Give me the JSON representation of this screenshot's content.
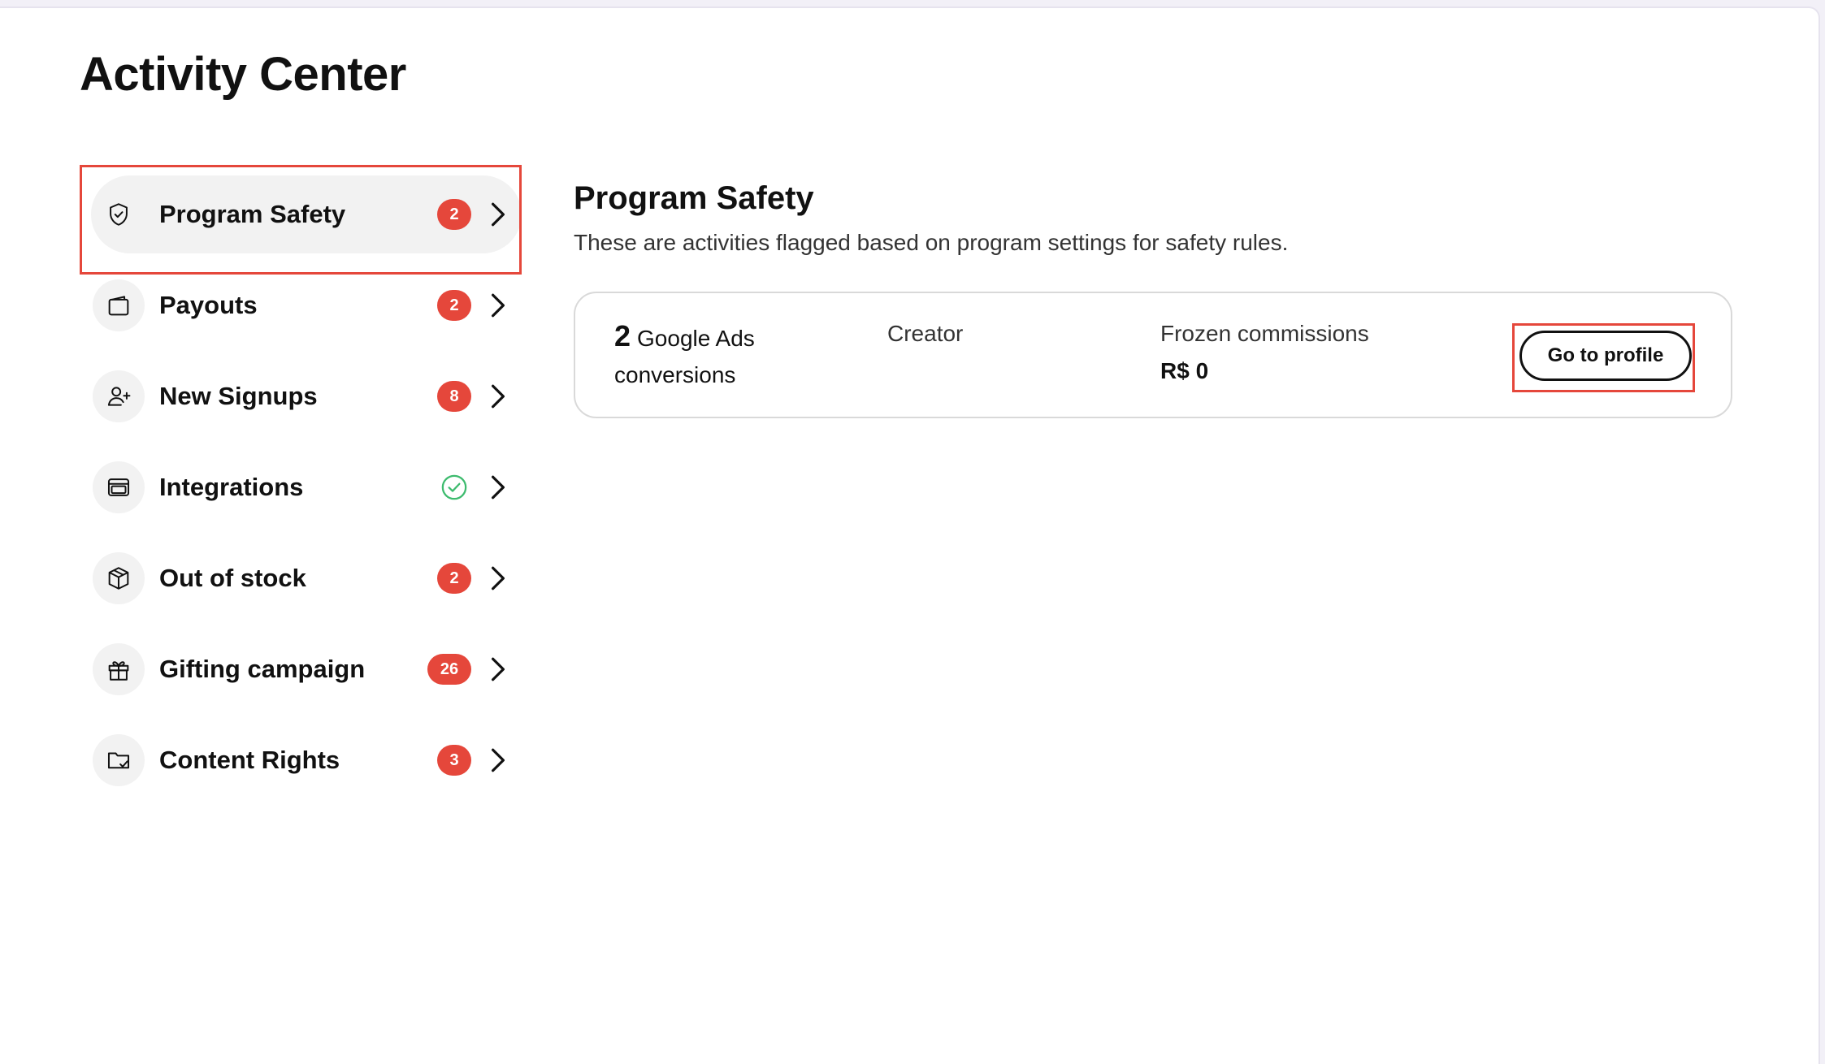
{
  "page": {
    "title": "Activity Center"
  },
  "sidebar": {
    "items": [
      {
        "label": "Program Safety",
        "badge": "2",
        "icon": "shield-icon",
        "active": true
      },
      {
        "label": "Payouts",
        "badge": "2",
        "icon": "wallet-icon",
        "active": false
      },
      {
        "label": "New Signups",
        "badge": "8",
        "icon": "user-plus-icon",
        "active": false
      },
      {
        "label": "Integrations",
        "status": "check",
        "icon": "browser-window-icon",
        "active": false
      },
      {
        "label": "Out of stock",
        "badge": "2",
        "icon": "box-icon",
        "active": false
      },
      {
        "label": "Gifting campaign",
        "badge": "26",
        "icon": "gift-icon",
        "active": false
      },
      {
        "label": "Content Rights",
        "badge": "3",
        "icon": "folder-check-icon",
        "active": false
      }
    ]
  },
  "main": {
    "title": "Program Safety",
    "subtitle": "These are activities flagged based on program settings for safety rules.",
    "card": {
      "count": "2",
      "count_label": "Google Ads conversions",
      "creator_label": "Creator",
      "frozen_label": "Frozen commissions",
      "frozen_value": "R$ 0",
      "button_label": "Go to profile"
    }
  },
  "colors": {
    "badge": "#e5473b",
    "highlight": "#e5473b",
    "check": "#3dbb6e",
    "active_bg": "#f2f2f2"
  }
}
